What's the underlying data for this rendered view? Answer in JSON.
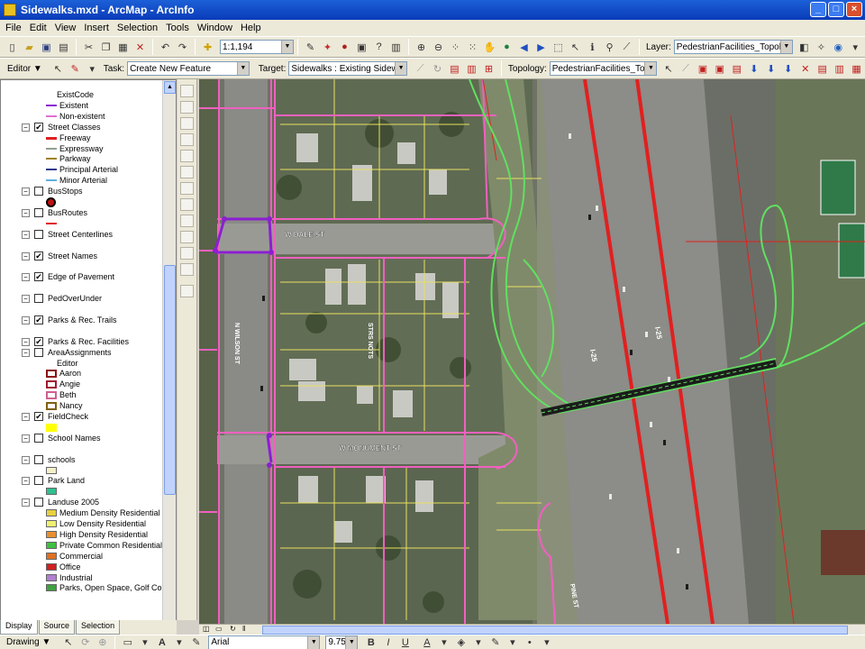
{
  "window": {
    "title": "Sidewalks.mxd - ArcMap - ArcInfo",
    "controls": [
      "_",
      "□",
      "×"
    ]
  },
  "menu": [
    "File",
    "Edit",
    "View",
    "Insert",
    "Selection",
    "Tools",
    "Window",
    "Help"
  ],
  "standard_toolbar": {
    "scale": "1:1,194",
    "layer_label": "Layer:",
    "layer_value": "PedestrianFacilities_Topology"
  },
  "editor_toolbar": {
    "editor_label": "Editor ▼",
    "task_label": "Task:",
    "task_value": "Create New Feature",
    "target_label": "Target:",
    "target_value": "Sidewalks : Existing Sidewalk",
    "topology_label": "Topology:",
    "topology_value": "PedestrianFacilities_Topology"
  },
  "toc": {
    "items": [
      {
        "type": "header",
        "label": "ExistCode"
      },
      {
        "type": "legend",
        "label": "Existent",
        "color": "#8b1fd0",
        "sym": "line"
      },
      {
        "type": "legend",
        "label": "Non-existent",
        "color": "#e070d0",
        "sym": "line"
      },
      {
        "type": "layer",
        "label": "Street Classes",
        "checked": true,
        "expanded": true
      },
      {
        "type": "legend",
        "label": "Freeway",
        "color": "#e02020",
        "sym": "thickline"
      },
      {
        "type": "legend",
        "label": "Expressway",
        "color": "#90a090",
        "sym": "line"
      },
      {
        "type": "legend",
        "label": "Parkway",
        "color": "#a08020",
        "sym": "line"
      },
      {
        "type": "legend",
        "label": "Principal Arterial",
        "color": "#303890",
        "sym": "line"
      },
      {
        "type": "legend",
        "label": "Minor Arterial",
        "color": "#60b0e0",
        "sym": "line"
      },
      {
        "type": "layer",
        "label": "BusStops",
        "checked": false,
        "expanded": true
      },
      {
        "type": "symbol",
        "sym": "busstop"
      },
      {
        "type": "layer",
        "label": "BusRoutes",
        "checked": false,
        "expanded": true
      },
      {
        "type": "symbol",
        "sym": "redline"
      },
      {
        "type": "layer",
        "label": "Street Centerlines",
        "checked": false,
        "expanded": true
      },
      {
        "type": "gap"
      },
      {
        "type": "layer",
        "label": "Street Names",
        "checked": true,
        "expanded": true
      },
      {
        "type": "gap"
      },
      {
        "type": "layer",
        "label": "Edge of Pavement",
        "checked": true,
        "expanded": true
      },
      {
        "type": "gap"
      },
      {
        "type": "layer",
        "label": "PedOverUnder",
        "checked": false,
        "expanded": true
      },
      {
        "type": "gap"
      },
      {
        "type": "layer",
        "label": "Parks & Rec. Trails",
        "checked": true,
        "expanded": true
      },
      {
        "type": "gap"
      },
      {
        "type": "layer",
        "label": "Parks & Rec. Facilities",
        "checked": true,
        "expanded": true
      },
      {
        "type": "layer",
        "label": "AreaAssignments",
        "checked": false,
        "expanded": true
      },
      {
        "type": "header",
        "label": "Editor"
      },
      {
        "type": "legend",
        "label": "Aaron",
        "color": "#8b1010",
        "sym": "box"
      },
      {
        "type": "legend",
        "label": "Angie",
        "color": "#a01830",
        "sym": "box"
      },
      {
        "type": "legend",
        "label": "Beth",
        "color": "#d06090",
        "sym": "box"
      },
      {
        "type": "legend",
        "label": "Nancy",
        "color": "#806010",
        "sym": "box"
      },
      {
        "type": "layer",
        "label": "FieldCheck",
        "checked": true,
        "expanded": true
      },
      {
        "type": "symbol",
        "sym": "yellowfill"
      },
      {
        "type": "layer",
        "label": "School Names",
        "checked": false,
        "expanded": true
      },
      {
        "type": "gap"
      },
      {
        "type": "layer",
        "label": "schools",
        "checked": false,
        "expanded": true
      },
      {
        "type": "symbol",
        "sym": "creamfill"
      },
      {
        "type": "layer",
        "label": "Park Land",
        "checked": false,
        "expanded": true
      },
      {
        "type": "symbol",
        "sym": "tealfill"
      },
      {
        "type": "layer",
        "label": "Landuse 2005",
        "checked": false,
        "expanded": true
      },
      {
        "type": "legend",
        "label": "Medium Density Residential",
        "color": "#e8d040",
        "sym": "fill"
      },
      {
        "type": "legend",
        "label": "Low Density Residential",
        "color": "#f0f070",
        "sym": "fill"
      },
      {
        "type": "legend",
        "label": "High Density Residential",
        "color": "#e89030",
        "sym": "fill"
      },
      {
        "type": "legend",
        "label": "Private Common Residential",
        "color": "#40c040",
        "sym": "fill"
      },
      {
        "type": "legend",
        "label": "Commercial",
        "color": "#e07020",
        "sym": "fill"
      },
      {
        "type": "legend",
        "label": "Office",
        "color": "#d02020",
        "sym": "fill"
      },
      {
        "type": "legend",
        "label": "Industrial",
        "color": "#b080d0",
        "sym": "fill"
      },
      {
        "type": "legend",
        "label": "Parks, Open Space, Golf Course",
        "color": "#40a040",
        "sym": "fill"
      }
    ],
    "tabs": [
      "Display",
      "Source",
      "Selection"
    ]
  },
  "map": {
    "street_labels": [
      "W DALE ST",
      "W MONUMENT ST",
      "I-25",
      "I-25",
      "PINE ST",
      "STRS NOTS",
      "N WILSON ST"
    ]
  },
  "drawing_toolbar": {
    "drawing_label": "Drawing ▼",
    "font": "Arial",
    "size": "9.75",
    "bold": "B",
    "italic": "I",
    "underline": "U"
  },
  "colors": {
    "sidewalk_pink": "#f060c0",
    "parcel_yellow": "#e8e060",
    "freeway_red": "#e02020",
    "trail_green": "#60e060",
    "selected_purple": "#8b1fd0"
  }
}
